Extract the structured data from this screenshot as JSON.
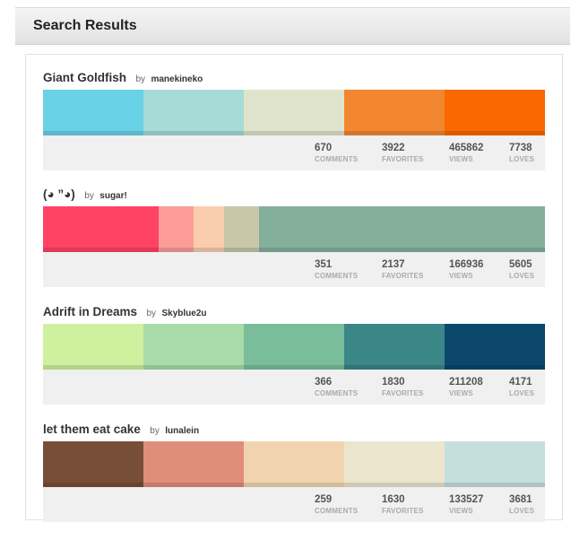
{
  "header": {
    "title": "Search Results"
  },
  "stat_labels": {
    "comments": "COMMENTS",
    "favorites": "FAVORITES",
    "views": "VIEWS",
    "loves": "LOVES"
  },
  "palettes": [
    {
      "title": "Giant Goldfish",
      "by": "by",
      "user": "manekineko",
      "colors": [
        "#69D2E7",
        "#A7DBD8",
        "#E0E4CC",
        "#F38630",
        "#FA6900"
      ],
      "widths": [
        0.2,
        0.2,
        0.2,
        0.2,
        0.2
      ],
      "comments": "670",
      "favorites": "3922",
      "views": "465862",
      "loves": "7738"
    },
    {
      "title": "(◕ ”◕)",
      "by": "by",
      "user": "sugar!",
      "colors": [
        "#FE4365",
        "#FC9D9A",
        "#F9CDAD",
        "#C8C8A9",
        "#83AF9B"
      ],
      "widths": [
        0.23,
        0.07,
        0.06,
        0.07,
        0.57
      ],
      "comments": "351",
      "favorites": "2137",
      "views": "166936",
      "loves": "5605"
    },
    {
      "title": "Adrift in Dreams",
      "by": "by",
      "user": "Skyblue2u",
      "colors": [
        "#CFF09E",
        "#A8DBA8",
        "#79BD9A",
        "#3B8686",
        "#0B486B"
      ],
      "widths": [
        0.2,
        0.2,
        0.2,
        0.2,
        0.2
      ],
      "comments": "366",
      "favorites": "1830",
      "views": "211208",
      "loves": "4171"
    },
    {
      "title": "let them eat cake",
      "by": "by",
      "user": "lunalein",
      "colors": [
        "#774F38",
        "#E08E79",
        "#F1D4AF",
        "#ECE5CE",
        "#C5E0DC"
      ],
      "widths": [
        0.2,
        0.2,
        0.2,
        0.2,
        0.2
      ],
      "comments": "259",
      "favorites": "1630",
      "views": "133527",
      "loves": "3681"
    }
  ]
}
